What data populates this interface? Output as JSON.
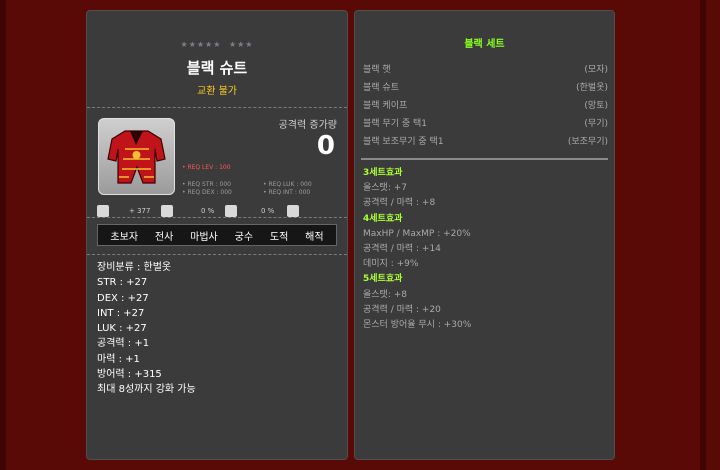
{
  "item": {
    "stars_row1": "★★★★★",
    "stars_row2": "★★★",
    "name": "블랙 슈트",
    "trade": "교환 불가",
    "attack_label": "공격력 증가량",
    "attack_value": "0",
    "req_lev": "• REQ LEV : 100",
    "req_str": "• REQ STR : 000",
    "req_luk": "• REQ LUK : 000",
    "req_dex": "• REQ DEX : 000",
    "req_int": "• REQ INT : 000",
    "stat_a": "+ 377",
    "stat_b": "0 %",
    "stat_c": "0 %",
    "jobs": [
      "초보자",
      "전사",
      "마법사",
      "궁수",
      "도적",
      "해적"
    ],
    "desc": [
      "장비분류 : 한벌옷",
      "STR : +27",
      "DEX : +27",
      "INT : +27",
      "LUK : +27",
      "공격력 : +1",
      "마력 : +1",
      "방어력 : +315",
      "최대 8성까지 강화 가능"
    ]
  },
  "set": {
    "title": "블랙 세트",
    "items": [
      {
        "name": "블랙 햇",
        "slot": "(모자)"
      },
      {
        "name": "블랙 슈트",
        "slot": "(한벌옷)"
      },
      {
        "name": "블랙 케이프",
        "slot": "(망토)"
      },
      {
        "name": "블랙 무기 중 택1",
        "slot": "(무기)"
      },
      {
        "name": "블랙 보조무기 중 택1",
        "slot": "(보조무기)"
      }
    ],
    "effects": [
      {
        "heading": "3세트효과",
        "lines": [
          "올스탯: +7",
          "공격력 / 마력 : +8"
        ]
      },
      {
        "heading": "4세트효과",
        "lines": [
          "MaxHP / MaxMP : +20%",
          "공격력 / 마력 : +14",
          "데미지 : +9%"
        ]
      },
      {
        "heading": "5세트효과",
        "lines": [
          "올스탯: +8",
          "공격력 / 마력 : +20",
          "몬스터 방어율 무시 : +30%"
        ]
      }
    ]
  },
  "colors": {
    "background": "#5a0a06",
    "panel": "#3b3b3b",
    "trade_text": "#ffcc22",
    "set_title": "#88ff22",
    "req_lev": "#ff5555"
  }
}
